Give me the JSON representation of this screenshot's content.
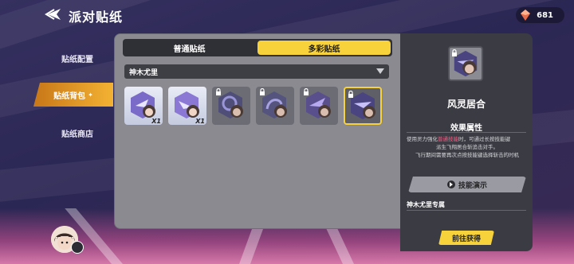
{
  "header": {
    "title": "派对贴纸",
    "currency_value": "681",
    "currency_icon": "crystal-gem-icon"
  },
  "menu": {
    "items": [
      {
        "label": "贴纸配置",
        "active": false
      },
      {
        "label": "贴纸背包",
        "active": true
      },
      {
        "label": "贴纸商店",
        "active": false
      }
    ]
  },
  "tabs": [
    {
      "label": "普通贴纸"
    },
    {
      "label": "多彩贴纸"
    }
  ],
  "filter": {
    "selected": "神木尤里"
  },
  "stickers": [
    {
      "count": "X1",
      "locked": false
    },
    {
      "count": "X1",
      "locked": false
    },
    {
      "count": "",
      "locked": true
    },
    {
      "count": "",
      "locked": true
    },
    {
      "count": "",
      "locked": true
    },
    {
      "count": "",
      "locked": true,
      "selected": true
    }
  ],
  "detail": {
    "name": "风灵居合",
    "section_title": "效果属性",
    "desc_line1_a": "使用灵力强化",
    "desc_line1_hl": "普通技能",
    "desc_line1_b": "时，可通过长按技能键",
    "desc_line2": "派生飞翔居合斩追击对手。",
    "desc_line3": "飞行期间需要再次点按技能键选择斩击的时机",
    "demo_label": "技能演示",
    "exclusive": "神木尤里专属",
    "get_label": "前往获得"
  },
  "colors": {
    "accent": "#f7d23a",
    "menu_active": "#f3b233",
    "highlight": "#ff5d86"
  }
}
